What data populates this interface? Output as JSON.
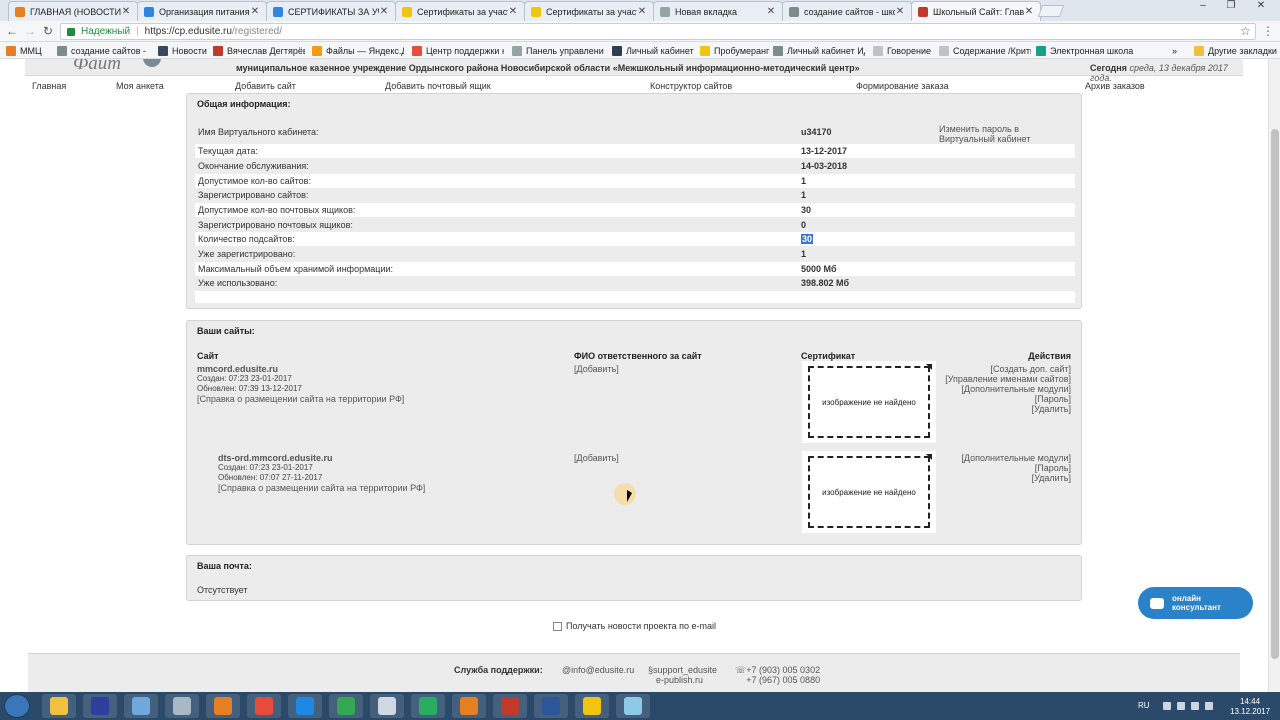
{
  "browser": {
    "tabs": [
      {
        "title": "ГЛАВНАЯ (НОВОСТИ)",
        "color": "#e67e22"
      },
      {
        "title": "Организация питания",
        "color": "#2e86de"
      },
      {
        "title": "СЕРТИФИКАТЫ ЗА УЧАСТ",
        "color": "#2e86de"
      },
      {
        "title": "Сертификаты за участие",
        "color": "#f1c40f"
      },
      {
        "title": "Сертификаты за участие",
        "color": "#f1c40f"
      },
      {
        "title": "Новая вкладка",
        "color": "#95a5a6"
      },
      {
        "title": "создание сайтов - школ",
        "color": "#7f8c8d"
      },
      {
        "title": "Школьный Сайт: Главна",
        "color": "#c0392b"
      }
    ],
    "close_glyph": "✕",
    "secure_label": "Надежный",
    "url_host": "https://cp.edusite.ru",
    "url_path": "/registered/",
    "bookmarks": [
      {
        "label": "ММЦ",
        "color": "#e67e22"
      },
      {
        "label": "создание сайтов - ш",
        "color": "#7f8c8d"
      },
      {
        "label": "Новости",
        "color": "#34495e"
      },
      {
        "label": "Вячеслав Дегтярёв",
        "color": "#c0392b"
      },
      {
        "label": "Файлы — Яндекс.Ди",
        "color": "#f39c12"
      },
      {
        "label": "Центр поддержки к",
        "color": "#e74c3c"
      },
      {
        "label": "Панель управления",
        "color": "#95a5a6"
      },
      {
        "label": "Личный кабинет",
        "color": "#2c3e50"
      },
      {
        "label": "Пробумеранг",
        "color": "#f1c40f"
      },
      {
        "label": "Личный кабинет ИД",
        "color": "#7f8c8d"
      },
      {
        "label": "Говорение",
        "color": "#bdc3c7"
      },
      {
        "label": "Содержание /Крити",
        "color": "#bdc3c7"
      },
      {
        "label": "Электронная школа",
        "color": "#16a085"
      }
    ],
    "more_bookmarks": "»",
    "other_bookmarks": "Другие закладки"
  },
  "header": {
    "logo_text": "Фaйт",
    "org": "муниципальное казенное учреждение Ордынского района Новосибирской области «Межшкольный информационно-методический центр»",
    "today_label": "Сегодня",
    "today_value": "среда, 13 декабря 2017 года."
  },
  "nav": [
    "Главная",
    "Моя анкета",
    "Добавить сайт",
    "Добавить почтовый ящик",
    "Конструктор сайтов",
    "Формирование заказа",
    "Архив заказов"
  ],
  "general": {
    "title": "Общая информация:",
    "cabinet_label": "Имя Виртуального кабинета:",
    "cabinet_value": "u34170",
    "change_password": "Изменить пароль в Виртуальный кабинет",
    "rows": [
      {
        "label": "Текущая дата:",
        "value": "13-12-2017"
      },
      {
        "label": "Окончание обслуживания:",
        "value": "14-03-2018"
      },
      {
        "label": "Допустимое кол-во сайтов:",
        "value": "1"
      },
      {
        "label": "Зарегистрировано сайтов:",
        "value": "1"
      },
      {
        "label": "Допустимое кол-во почтовых ящиков:",
        "value": "30"
      },
      {
        "label": "Зарегистрировано почтовых ящиков:",
        "value": "0"
      },
      {
        "label": "Количество подсайтов:",
        "value": "30"
      },
      {
        "label": "Уже зарегистрировано:",
        "value": "1"
      },
      {
        "label": "Максимальный объем хранимой информации:",
        "value": "5000 Мб"
      },
      {
        "label": "Уже использовано:",
        "value": "398.802 Мб"
      }
    ]
  },
  "sites": {
    "title": "Ваши сайты:",
    "col_site": "Сайт",
    "col_person": "ФИО ответственного за сайт",
    "col_cert": "Сертификат",
    "col_actions": "Действия",
    "cert_missing": "изображение не найдено",
    "items": [
      {
        "name": "mmcord.edusite.ru",
        "created": "Создан: 07:23 23-01-2017",
        "updated": "Обновлен: 07:39 13-12-2017",
        "help": "[Справка о размещении сайта на территории РФ]",
        "add": "[Добавить]",
        "actions": [
          "[Создать доп. сайт]",
          "[Управление именами сайтов]",
          "[Дополнительные модули]",
          "[Пароль]",
          "[Удалить]"
        ]
      },
      {
        "name": "dts-ord.mmcord.edusite.ru",
        "created": "Создан: 07:23 23-01-2017",
        "updated": "Обновлен: 07:07 27-11-2017",
        "help": "[Справка о размещении сайта на территории РФ]",
        "add": "[Добавить]",
        "actions": [
          "[Дополнительные модули]",
          "[Пароль]",
          "[Удалить]"
        ]
      }
    ]
  },
  "mail": {
    "title": "Ваша почта:",
    "status": "Отсутствует"
  },
  "news_opt": "Получать новости проекта по e-mail",
  "footer": {
    "support_label": "Служба поддержки:",
    "email": "info@edusite.ru",
    "skype": "support_edusite",
    "skype2": "e-publish.ru",
    "phone1": "+7 (903) 005 0302",
    "phone2": "+7 (967) 005 0880"
  },
  "chat": {
    "line1": "онлайн",
    "line2": "консультант"
  },
  "taskbar": {
    "apps": [
      {
        "name": "explorer",
        "color": "#f0c040"
      },
      {
        "name": "save",
        "color": "#2c3e9e"
      },
      {
        "name": "monitor",
        "color": "#6fa8dc"
      },
      {
        "name": "gear",
        "color": "#aab7c4"
      },
      {
        "name": "firefox",
        "color": "#e67e22"
      },
      {
        "name": "office",
        "color": "#e74c3c"
      },
      {
        "name": "teamviewer",
        "color": "#1e88e5"
      },
      {
        "name": "chrome",
        "color": "#34a853"
      },
      {
        "name": "window",
        "color": "#cfd8e3"
      },
      {
        "name": "mail-at",
        "color": "#27ae60"
      },
      {
        "name": "pencil",
        "color": "#e67e22"
      },
      {
        "name": "pdf",
        "color": "#c0392b"
      },
      {
        "name": "word",
        "color": "#2b579a"
      },
      {
        "name": "paint",
        "color": "#f1c40f"
      },
      {
        "name": "notes",
        "color": "#8ecae6"
      }
    ],
    "lang": "RU",
    "time": "14:44",
    "date": "13.12.2017"
  }
}
